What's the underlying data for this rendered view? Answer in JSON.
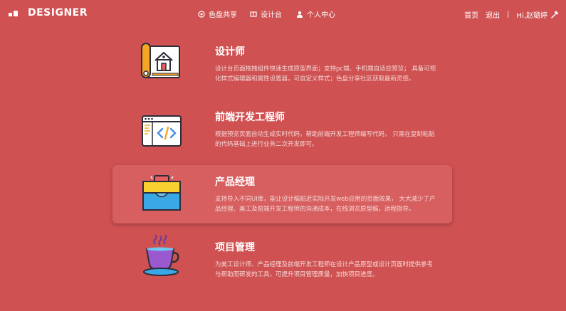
{
  "header": {
    "brand": "DESIGNER",
    "nav": [
      {
        "label": "色盘共享",
        "icon": "palette-icon"
      },
      {
        "label": "设计台",
        "icon": "book-icon"
      },
      {
        "label": "个人中心",
        "icon": "user-icon"
      }
    ],
    "right": {
      "home": "首页",
      "logout": "退出",
      "separator": "|",
      "greeting": "Hi,赵璐婷",
      "tool_icon": "hammer-icon"
    }
  },
  "roles": [
    {
      "title": "设计师",
      "icon": "blueprint-house-icon",
      "description": "设计台页面拖拽组件快速生成原型界面；支持pc端、手机端自适应预览； 具备可视化样式编辑器和属性设置器，可自定义样式；色盘分享社区获取最新灵感。"
    },
    {
      "title": "前端开发工程师",
      "icon": "code-window-icon",
      "description": "根据预览页面自动生成实时代码，帮助前端开发工程师编写代码， 只需在复制粘贴的代码基础上进行业务二次开发即可。"
    },
    {
      "title": "产品经理",
      "icon": "briefcase-icon",
      "description": "支持导入不同UI库，能让设计稿贴近实际开发web应用的页面效果， 大大减少了产品经理、美工及前端开发工程师的沟通成本，在线浏览原型稿，远程指导。",
      "highlighted": true
    },
    {
      "title": "项目管理",
      "icon": "coffee-cup-icon",
      "description": "为美工设计师、产品经理及前端开发工程师在设计产品原型或设计页面时提供参考与帮助而研发的工具，可提升项目管理质量，加快项目进度。"
    }
  ]
}
